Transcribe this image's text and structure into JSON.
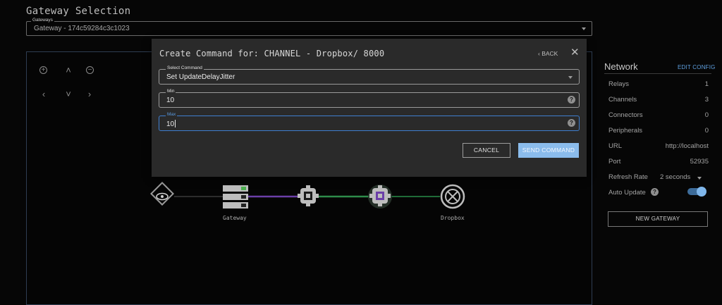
{
  "page": {
    "title": "Gateway Selection"
  },
  "gateway_select": {
    "label": "Gateways",
    "value": "Gateway - 174c59284c3c1023"
  },
  "topology": {
    "nodes": [
      {
        "label": ""
      },
      {
        "label": "Gateway"
      },
      {
        "label": ""
      },
      {
        "label": ""
      },
      {
        "label": "Dropbox"
      }
    ],
    "link_colors": {
      "gray": "#3a3a3a",
      "purple": "#6b3fa8",
      "green": "#2e8b4a"
    }
  },
  "network": {
    "title": "Network",
    "edit_label": "EDIT CONFIG",
    "rows": [
      {
        "key": "Relays",
        "value": "1"
      },
      {
        "key": "Channels",
        "value": "3"
      },
      {
        "key": "Connectors",
        "value": "0"
      },
      {
        "key": "Peripherals",
        "value": "0"
      },
      {
        "key": "URL",
        "value": "http://localhost"
      },
      {
        "key": "Port",
        "value": "52935"
      }
    ],
    "refresh_rate": {
      "label": "Refresh Rate",
      "value": "2 seconds"
    },
    "auto_update": {
      "label": "Auto Update",
      "enabled": true
    },
    "new_gateway_label": "NEW GATEWAY"
  },
  "modal": {
    "title": "Create Command for: CHANNEL - Dropbox/ 8000",
    "back_label": "BACK",
    "select_command": {
      "label": "Select Command",
      "value": "Set UpdateDelayJitter"
    },
    "min": {
      "label": "Min",
      "value": "10"
    },
    "max": {
      "label": "Max",
      "value": "10"
    },
    "cancel_label": "CANCEL",
    "send_label": "SEND COMMAND"
  },
  "colors": {
    "accent": "#8bbcec",
    "link": "#5fa0e0",
    "focus": "#3f7fd0"
  }
}
